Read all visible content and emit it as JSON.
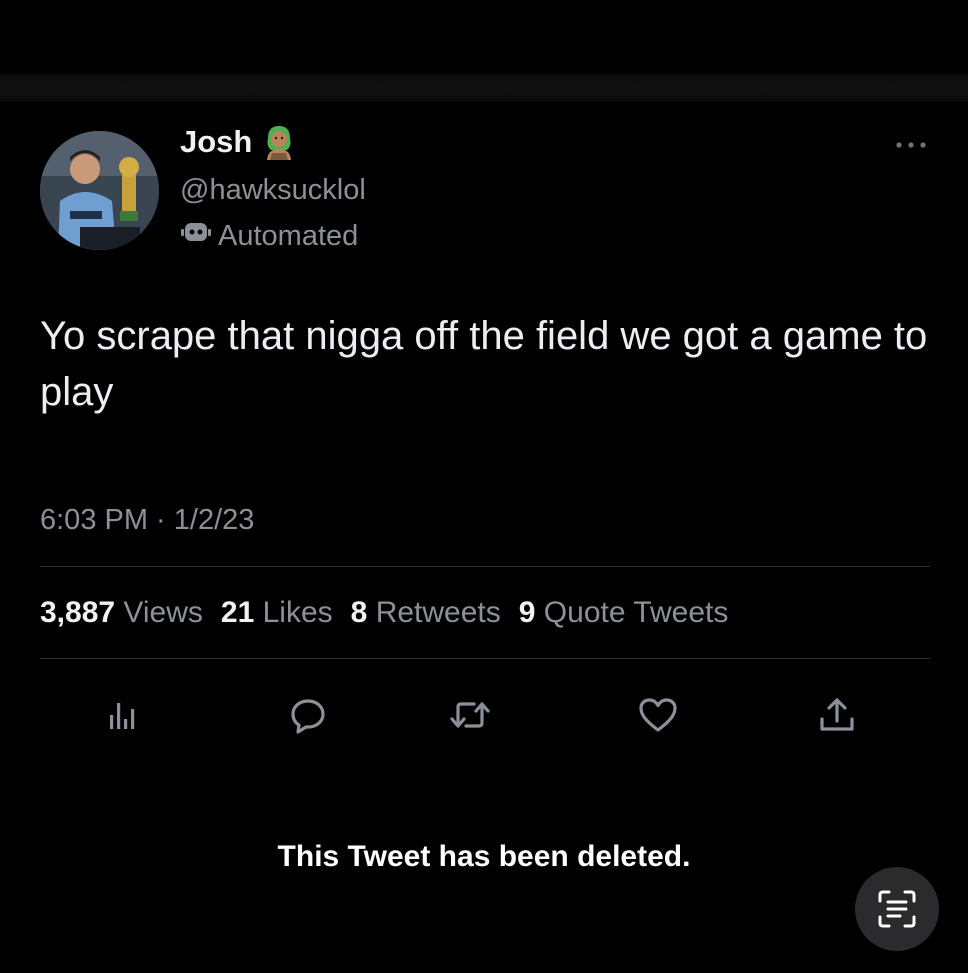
{
  "author": {
    "display_name": "Josh",
    "handle": "@hawksucklol",
    "badge_label": "Automated",
    "badge_icon": "bot-icon",
    "name_emoji": "person-emoji",
    "avatar": "profile-avatar"
  },
  "tweet": {
    "text": "Yo scrape that nigga off the field we got a game to play",
    "timestamp": "6:03 PM · 1/2/23"
  },
  "stats": {
    "views_count": "3,887",
    "views_label": "Views",
    "likes_count": "21",
    "likes_label": "Likes",
    "retweets_count": "8",
    "retweets_label": "Retweets",
    "quotes_count": "9",
    "quotes_label": "Quote Tweets"
  },
  "actions": [
    "analytics-icon",
    "reply-icon",
    "retweet-icon",
    "like-icon",
    "share-icon"
  ],
  "status_message": "This Tweet has been deleted.",
  "colors": {
    "background": "#000000",
    "primary_text": "#e7e9ea",
    "secondary_text": "#8b9199",
    "divider": "#2a2d31"
  }
}
